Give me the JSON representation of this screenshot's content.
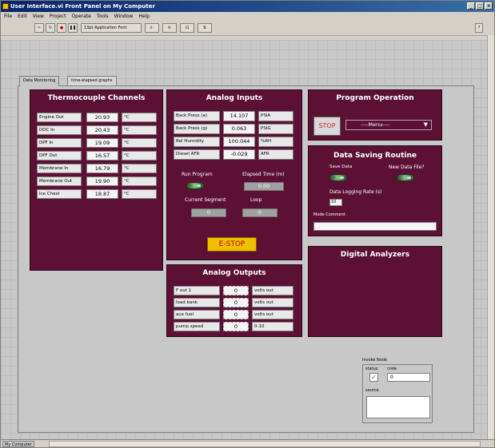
{
  "window": {
    "title": "User Interface.vi Front Panel on My Computer"
  },
  "menu": [
    "File",
    "Edit",
    "View",
    "Project",
    "Operate",
    "Tools",
    "Window",
    "Help"
  ],
  "toolbar": {
    "font": "13pt Application Font"
  },
  "tabs": [
    "Data Monitoring",
    "time-elapsed graphs"
  ],
  "thermocouple": {
    "title": "Thermocouple Channels",
    "rows": [
      {
        "label": "Engine Out",
        "value": "20.93",
        "unit": "°C"
      },
      {
        "label": "DOC In",
        "value": "20.43",
        "unit": "°C"
      },
      {
        "label": "DPF In",
        "value": "19.09",
        "unit": "°C"
      },
      {
        "label": "DPF Out",
        "value": "16.57",
        "unit": "°C"
      },
      {
        "label": "Membrane In",
        "value": "16.79",
        "unit": "°C"
      },
      {
        "label": "Membrane Out",
        "value": "19.90",
        "unit": "°C"
      },
      {
        "label": "Ice Chest",
        "value": "18.87",
        "unit": "°C"
      }
    ]
  },
  "analog_inputs": {
    "title": "Analog Inputs",
    "rows": [
      {
        "label": "Back Press (a)",
        "value": "14.107",
        "unit": "PSIA"
      },
      {
        "label": "Back Press (g)",
        "value": "0.063",
        "unit": "PSIG"
      },
      {
        "label": "Rel Humidity",
        "value": "100.044",
        "unit": "%RH"
      },
      {
        "label": "Diesel AFR",
        "value": "-0.029",
        "unit": "AFR"
      }
    ],
    "run_program_label": "Run Program",
    "elapsed_label": "Elapsed Time (m)",
    "elapsed_value": "0.00",
    "segment_label": "Current Segment",
    "segment_value": "0",
    "loop_label": "Loop",
    "loop_value": "0",
    "estop_label": "E-STOP"
  },
  "analog_outputs": {
    "title": "Analog Outputs",
    "rows": [
      {
        "label": "F out 1",
        "value": "0",
        "unit": "volts out"
      },
      {
        "label": "load bank",
        "value": "0",
        "unit": "volts out"
      },
      {
        "label": "aux fuel",
        "value": "0",
        "unit": "volts out"
      },
      {
        "label": "pump speed",
        "value": "0",
        "unit": "0-10"
      }
    ]
  },
  "program_operation": {
    "title": "Program Operation",
    "stop_label": "STOP",
    "menu_value": "----Menu----"
  },
  "data_saving": {
    "title": "Data Saving Routine",
    "save_label": "Save Data",
    "new_file_label": "New Data File?",
    "rate_label": "Data Logging Rate (s)",
    "rate_value": "10",
    "comment_label": "Mode Comment",
    "comment_value": ""
  },
  "digital_analyzers": {
    "title": "Digital Analyzers"
  },
  "invoke_node": {
    "title": "Invoke Node",
    "status_label": "status",
    "code_label": "code",
    "code_value": "0",
    "source_label": "source",
    "source_value": ""
  },
  "statusbar": {
    "label": "My Computer"
  },
  "colors": {
    "panel_box": "#5c1134",
    "estop": "#f0c000",
    "stop_button": "#d04040"
  }
}
